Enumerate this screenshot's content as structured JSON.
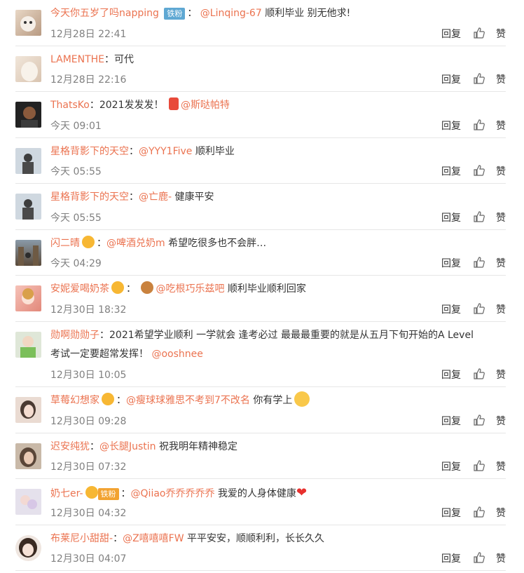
{
  "labels": {
    "reply": "回复",
    "like": "赞"
  },
  "comments": [
    {
      "name": "今天你五岁了吗napping",
      "badge": "铁粉",
      "sep": "：",
      "mention": "@Linqing-67",
      "text": "顺利毕业 别无他求!",
      "time": "12月28日 22:41"
    },
    {
      "name": "LAMENTHE",
      "sep": "：",
      "text": "可代",
      "time": "12月28日 22:16"
    },
    {
      "name": "ThatsKo",
      "sep": "：",
      "text": "2021发发发！",
      "mention": "@斯哒帕特",
      "time": "今天 09:01"
    },
    {
      "name": "星格背影下的天空",
      "sep": "：",
      "mention": "@YYY1Five",
      "text": "顺利毕业",
      "time": "今天 05:55"
    },
    {
      "name": "星格背影下的天空",
      "sep": "：",
      "mention": "@亡鹿-",
      "text": "健康平安",
      "time": "今天 05:55"
    },
    {
      "name": "闪二晴",
      "sep": "：",
      "mention": "@啤酒兑奶m",
      "text": "希望吃很多也不会胖…",
      "time": "今天 04:29"
    },
    {
      "name": "安妮爱喝奶茶",
      "sep": "：",
      "mention": "@吃根巧乐兹吧",
      "text": "顺利毕业顺利回家",
      "time": "12月30日 18:32"
    },
    {
      "name": "勋啊勋勋子",
      "sep": "：",
      "text": "2021希望学业顺利 一学就会 逢考必过 最最最重要的就是从五月下旬开始的A Level",
      "text2": "考试一定要超常发挥！",
      "mention": "@ooshnee",
      "time": "12月30日 10:05"
    },
    {
      "name": "草莓幻想家",
      "sep": "：",
      "mention": "@瘦球球雅思不考到7不改名",
      "text": "你有学上",
      "time": "12月30日 09:28"
    },
    {
      "name": "迟安纯犹",
      "sep": "：",
      "mention": "@长腿Justin",
      "text": "祝我明年精神稳定",
      "time": "12月30日 07:32"
    },
    {
      "name": "奶七er-",
      "badge": "铁粉",
      "sep": "：",
      "mention": "@Qiiao乔乔乔乔乔",
      "text": "我爱的人身体健康",
      "time": "12月30日 04:32"
    },
    {
      "name": "布莱尼小甜甜-",
      "sep": "：",
      "mention": "@Z嘻嘻嘻FW",
      "text": "平平安安，顺顺利利，长长久久",
      "time": "12月30日 04:07"
    }
  ],
  "colors": {
    "link": "#eb7350",
    "badge_blue": "#5fa8d3",
    "badge_gold": "#f2a230"
  }
}
